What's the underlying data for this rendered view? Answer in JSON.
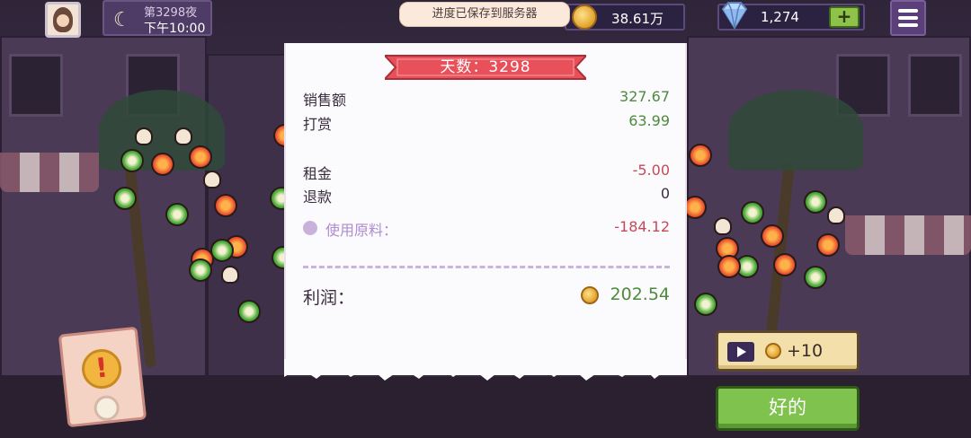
{
  "top_bar": {
    "night_label": "第3298夜",
    "time_label": "下午10:00",
    "toast": "进度已保存到服务器",
    "coins": "38.61万",
    "gems": "1,274",
    "plus": "+"
  },
  "receipt": {
    "banner": "天数：3298",
    "rows": [
      {
        "label": "销售额",
        "value": "327.67"
      },
      {
        "label": "打赏",
        "value": "63.99"
      },
      {
        "label": "租金",
        "value": "-5.00"
      },
      {
        "label": "退款",
        "value": "0"
      },
      {
        "label": "使用原料：",
        "value": "-184.12"
      }
    ],
    "profit_label": "利润：",
    "profit_value": "202.54"
  },
  "buttons": {
    "ad_reward": "+10",
    "ok": "好的"
  },
  "alert": {
    "mark": "!"
  },
  "colors": {
    "positive": "#4e8a3e",
    "negative": "#c44a5a",
    "banner": "#e8505a",
    "ok_button": "#7fc34e"
  },
  "icons": [
    "avatar",
    "moon-icon",
    "coin-icon",
    "gem-icon",
    "plus-icon",
    "menu-icon",
    "play-icon",
    "alert-icon"
  ]
}
